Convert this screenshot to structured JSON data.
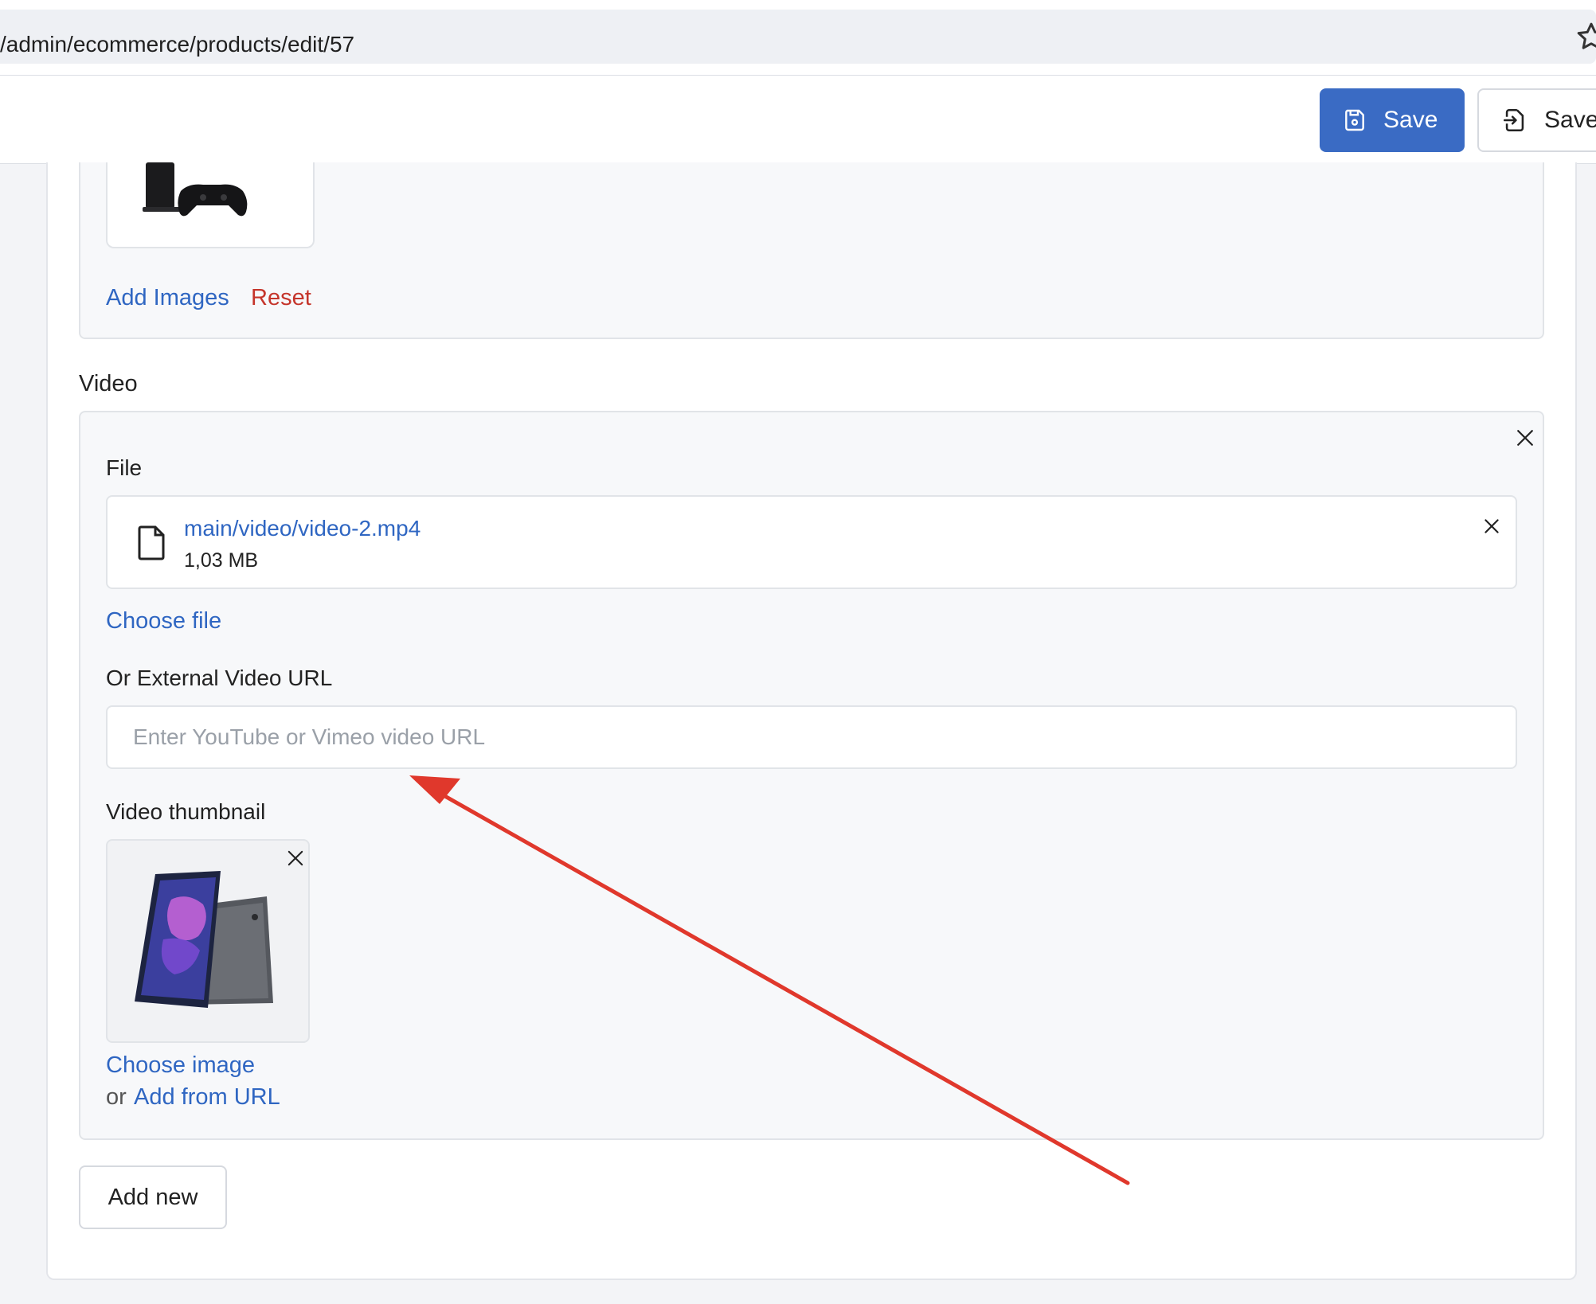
{
  "browser": {
    "url": "/admin/ecommerce/products/edit/57"
  },
  "toolbar": {
    "save_label": "Save",
    "save_exit_label": "Save"
  },
  "images": {
    "add_label": "Add Images",
    "reset_label": "Reset"
  },
  "video": {
    "section_title": "Video",
    "file_label": "File",
    "file_name": "main/video/video-2.mp4",
    "file_size": "1,03 MB",
    "choose_file_label": "Choose file",
    "external_url_label": "Or External Video URL",
    "external_url_placeholder": "Enter YouTube or Vimeo video URL",
    "external_url_value": "",
    "thumbnail_label": "Video thumbnail",
    "choose_image_label": "Choose image",
    "or_label": "or",
    "add_from_url_label": "Add from URL",
    "add_new_label": "Add new"
  },
  "colors": {
    "primary": "#3a6bc4",
    "link": "#2f66c2",
    "danger": "#c5352b",
    "annotation_arrow": "#e0382c"
  }
}
